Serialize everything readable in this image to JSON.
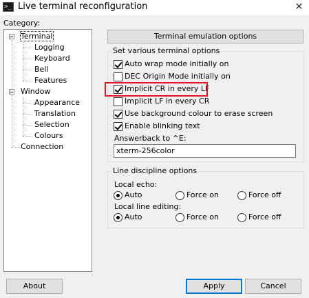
{
  "window": {
    "title": "Live terminal reconfiguration",
    "icon_glyph": ">_",
    "close_glyph": "✕"
  },
  "category": {
    "label": "Category:",
    "items": [
      {
        "label": "Terminal",
        "expanded": true,
        "selected": true
      },
      {
        "label": "Logging"
      },
      {
        "label": "Keyboard"
      },
      {
        "label": "Bell"
      },
      {
        "label": "Features"
      },
      {
        "label": "Window",
        "expanded": true
      },
      {
        "label": "Appearance"
      },
      {
        "label": "Translation"
      },
      {
        "label": "Selection"
      },
      {
        "label": "Colours"
      },
      {
        "label": "Connection"
      }
    ]
  },
  "panel": {
    "header_button": "Terminal emulation options",
    "options_group": {
      "title": "Set various terminal options",
      "checkboxes": [
        {
          "label": "Auto wrap mode initially on",
          "checked": true
        },
        {
          "label": "DEC Origin Mode initially on",
          "checked": false
        },
        {
          "label": "Implicit CR in every LF",
          "checked": true,
          "highlighted": true
        },
        {
          "label": "Implicit LF in every CR",
          "checked": false
        },
        {
          "label": "Use background colour to erase screen",
          "checked": true
        },
        {
          "label": "Enable blinking text",
          "checked": true
        }
      ],
      "answerback_label": "Answerback to ^E:",
      "answerback_value": "xterm-256color"
    },
    "line_discipline": {
      "title": "Line discipline options",
      "local_echo": {
        "label": "Local echo:",
        "options": [
          "Auto",
          "Force on",
          "Force off"
        ],
        "selected": "Auto"
      },
      "local_line_editing": {
        "label": "Local line editing:",
        "options": [
          "Auto",
          "Force on",
          "Force off"
        ],
        "selected": "Auto"
      }
    }
  },
  "buttons": {
    "about": "About",
    "apply": "Apply",
    "cancel": "Cancel"
  },
  "colors": {
    "highlight_box": "#e81123",
    "default_button_border": "#0078d7"
  }
}
